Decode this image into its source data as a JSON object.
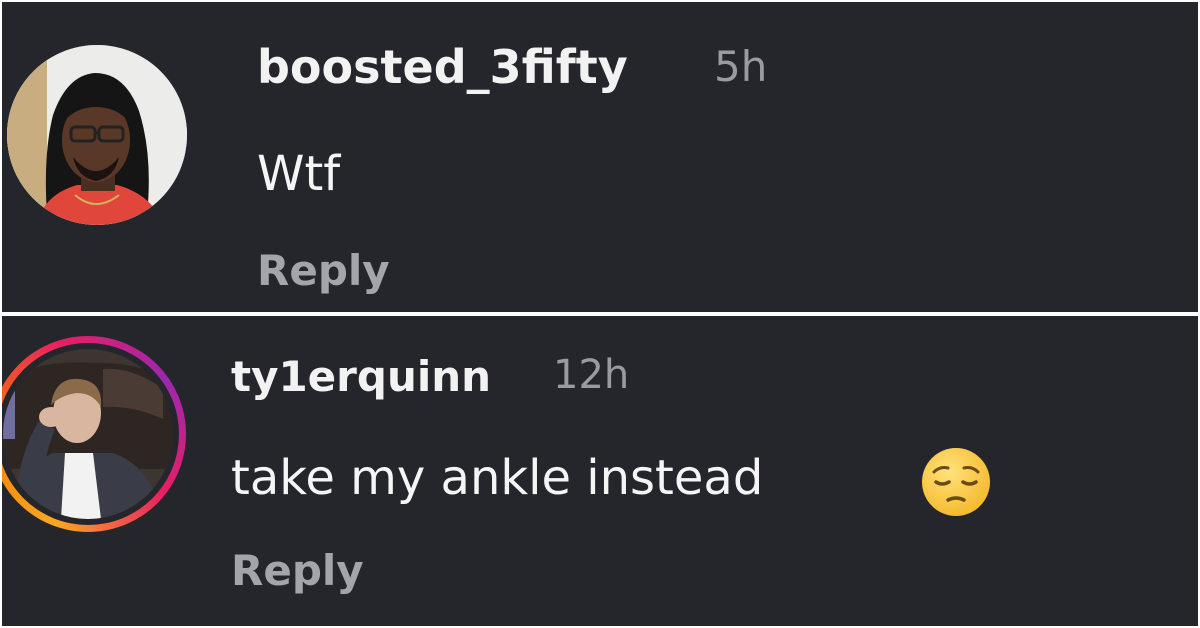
{
  "comments": [
    {
      "username": "boosted_3fifty",
      "time": "5h",
      "text": "Wtf",
      "reply_label": "Reply",
      "story_ring": false
    },
    {
      "username": "ty1erquinn",
      "time": "12h",
      "text": "take my ankle instead",
      "emoji": "pensive-face",
      "reply_label": "Reply",
      "story_ring": true
    }
  ],
  "colors": {
    "background": "#25262b",
    "username": "#f2f2f2",
    "comment_text": "#f5f5f5",
    "secondary_text": "#9a9ba0",
    "story_ring": [
      "#f9a825",
      "#e91e63",
      "#9c27b0"
    ]
  }
}
